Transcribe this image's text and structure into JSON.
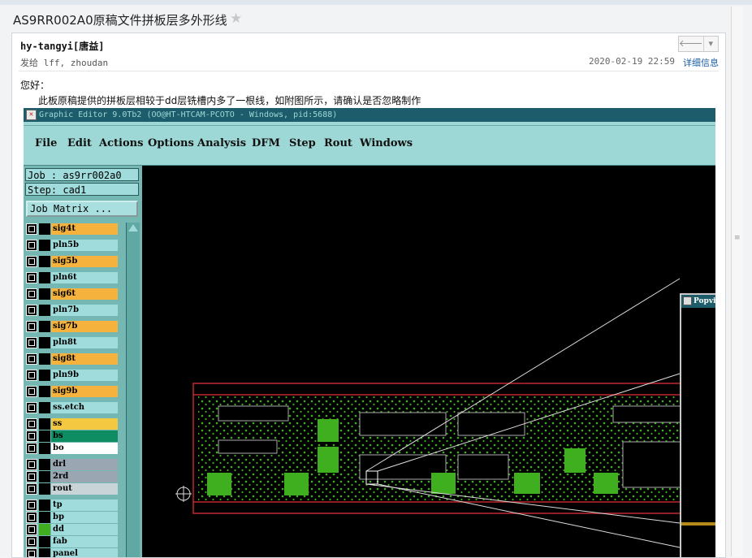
{
  "email": {
    "subject": "AS9RR002A0原稿文件拼板层多外形线",
    "star_icon": "star-icon",
    "sender": "hy-tangyi[唐益]",
    "recipients": "发给 lff, zhoudan",
    "datetime": "2020-02-19 22:59",
    "details_link": "详细信息",
    "greeting": "您好：",
    "body_line": "此板原稿提供的拼板层相较于dd层铣槽内多了一根线，如附图所示，请确认是否忽略制作",
    "header_buttons": [
      "reply-icon",
      "dropdown-icon"
    ]
  },
  "graphic_editor": {
    "title": "Graphic Editor 9.0Tb2 (OO@HT-HTCAM-PCOTO - Windows, pid:5688)",
    "menu": [
      "File",
      "Edit",
      "Actions",
      "Options",
      "Analysis",
      "DFM",
      "Step",
      "Rout",
      "Windows"
    ],
    "job_label": "Job : as9rr002a0",
    "step_label": "Step: cad1",
    "job_matrix_button": "Job Matrix ...",
    "layers": [
      {
        "name": "sig4t",
        "color": "#f5b23c"
      },
      {
        "name": "pln5b",
        "color": "#a0dcdc"
      },
      {
        "name": "sig5b",
        "color": "#f5b23c"
      },
      {
        "name": "pln6t",
        "color": "#a0dcdc"
      },
      {
        "name": "sig6t",
        "color": "#f5b23c"
      },
      {
        "name": "pln7b",
        "color": "#a0dcdc"
      },
      {
        "name": "sig7b",
        "color": "#f5b23c"
      },
      {
        "name": "pln8t",
        "color": "#a0dcdc"
      },
      {
        "name": "sig8t",
        "color": "#f5b23c"
      },
      {
        "name": "pln9b",
        "color": "#a0dcdc"
      },
      {
        "name": "sig9b",
        "color": "#f5b23c"
      },
      {
        "name": "ss.etch",
        "color": "#a0dcdc"
      },
      {
        "name": "ss",
        "color": "#f5c842"
      },
      {
        "name": "bs",
        "color": "#0e8c62"
      },
      {
        "name": "bo",
        "color": "#ffffff"
      },
      {
        "name": "drl",
        "color": "#9aa6b2"
      },
      {
        "name": "2rd",
        "color": "#9aa6b2"
      },
      {
        "name": "rout",
        "color": "#c8d4d8"
      },
      {
        "name": "tp",
        "color": "#a0dcdc"
      },
      {
        "name": "bp",
        "color": "#a0dcdc"
      },
      {
        "name": "dd",
        "color": "#a0dcdc"
      },
      {
        "name": "fab",
        "color": "#a0dcdc"
      },
      {
        "name": "panel",
        "color": "#a0dcdc"
      }
    ],
    "popview_title": "Popvie"
  }
}
